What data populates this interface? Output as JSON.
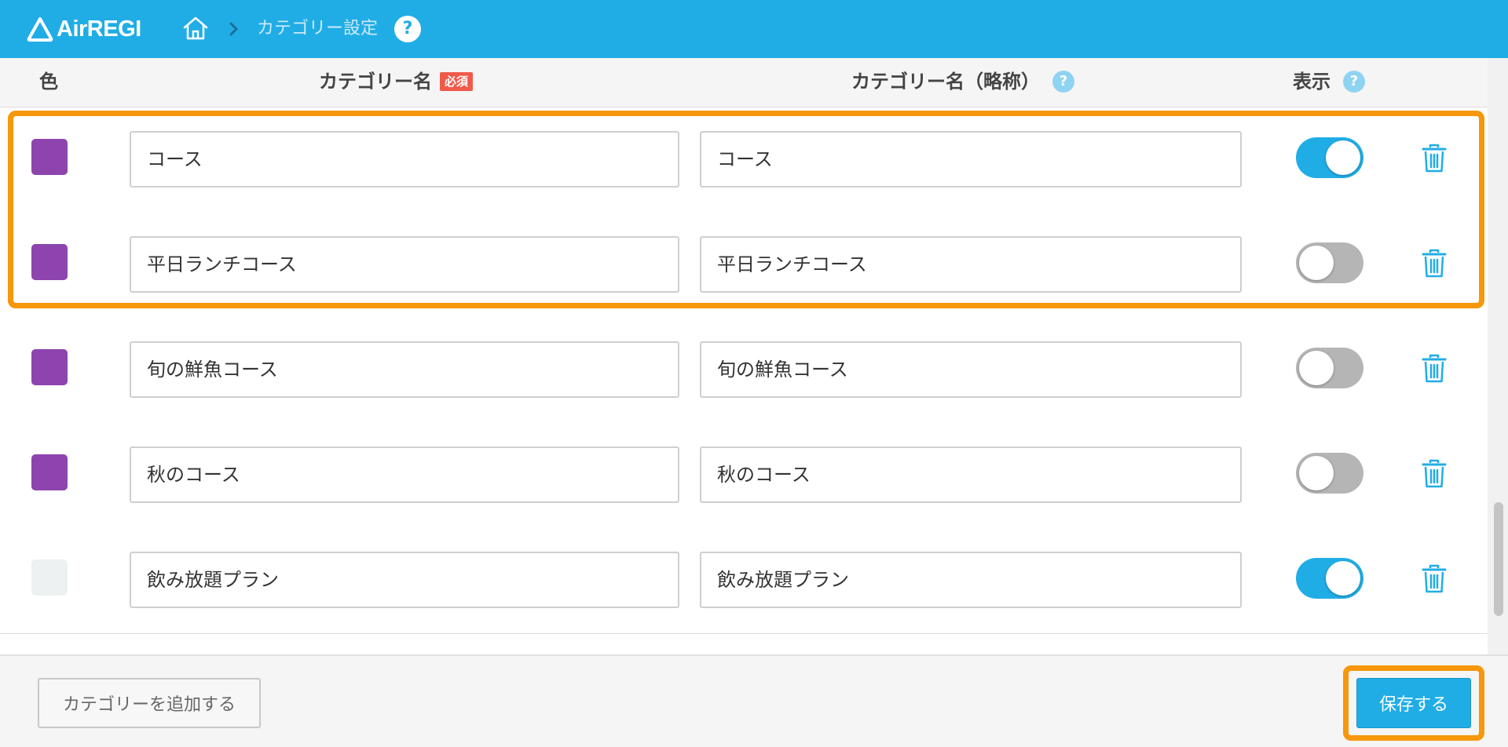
{
  "app": {
    "logo_text": "AirREGI"
  },
  "breadcrumb": {
    "current": "カテゴリー設定",
    "help": "?"
  },
  "table": {
    "headers": {
      "color": "色",
      "name": "カテゴリー名",
      "required_badge": "必須",
      "short_name": "カテゴリー名（略称）",
      "display": "表示",
      "help": "?"
    },
    "rows": [
      {
        "color": "#8e44ad",
        "name": "コース",
        "short_name": "コース",
        "display": true
      },
      {
        "color": "#8e44ad",
        "name": "平日ランチコース",
        "short_name": "平日ランチコース",
        "display": false
      },
      {
        "color": "#8e44ad",
        "name": "旬の鮮魚コース",
        "short_name": "旬の鮮魚コース",
        "display": false
      },
      {
        "color": "#8e44ad",
        "name": "秋のコース",
        "short_name": "秋のコース",
        "display": false
      },
      {
        "color": "#eef1f1",
        "name": "飲み放題プラン",
        "short_name": "飲み放題プラン",
        "display": true
      }
    ]
  },
  "footer": {
    "add_label": "カテゴリーを追加する",
    "save_label": "保存する"
  },
  "colors": {
    "brand": "#20ade6",
    "highlight": "#f7970b",
    "toggle_off": "#b5b5b5"
  }
}
